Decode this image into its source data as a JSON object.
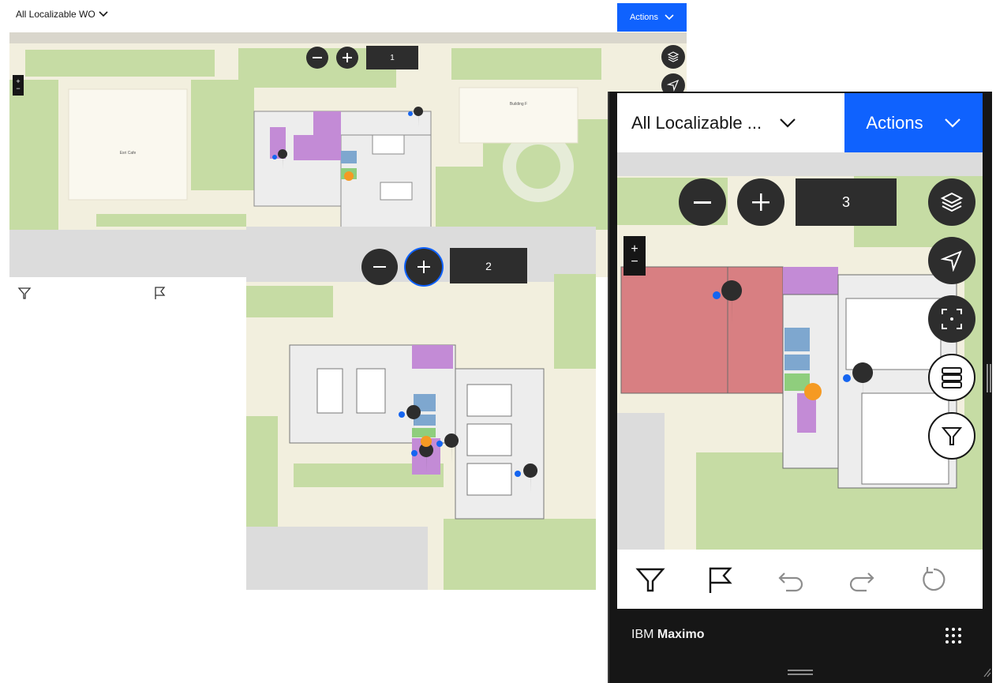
{
  "panel1": {
    "dropdown_label": "All Localizable WO",
    "actions_label": "Actions",
    "floor_value": "1",
    "building_labels": [
      "Esri Cafe",
      "Building F"
    ],
    "zoom_in_symbol": "+",
    "zoom_out_symbol": "−",
    "icons": [
      "chevron-down-icon",
      "layers-icon",
      "navigate-icon",
      "filter-icon",
      "flag-icon"
    ]
  },
  "panel2": {
    "floor_value": "2",
    "icons": [
      "zoom-out-icon",
      "zoom-in-icon",
      "wrench-marker-icon"
    ]
  },
  "panel3": {
    "dropdown_label": "All Localizable ...",
    "actions_label": "Actions",
    "floor_value": "3",
    "zoom_in_symbol": "+",
    "zoom_out_symbol": "−",
    "footer": {
      "brand_prefix": "IBM ",
      "brand_name": "Maximo"
    },
    "toolbar_icons": [
      "filter-icon",
      "flag-icon",
      "undo-icon",
      "redo-icon",
      "reset-icon"
    ],
    "side_icons": [
      "layers-icon",
      "navigate-icon",
      "focus-icon",
      "floors-icon",
      "filter-icon"
    ]
  },
  "colors": {
    "accent": "#0f62fe",
    "map_base": "#f2efde",
    "park": "#c6dca4",
    "road": "#f7f2c5",
    "room_purple": "#c38bd6",
    "room_red": "#d87f82",
    "room_blue": "#7ea7cf",
    "room_green": "#8fce7d",
    "marker_dark": "#2d2d2d",
    "marker_orange": "#f59a23",
    "dot_blue": "#1565f0"
  }
}
